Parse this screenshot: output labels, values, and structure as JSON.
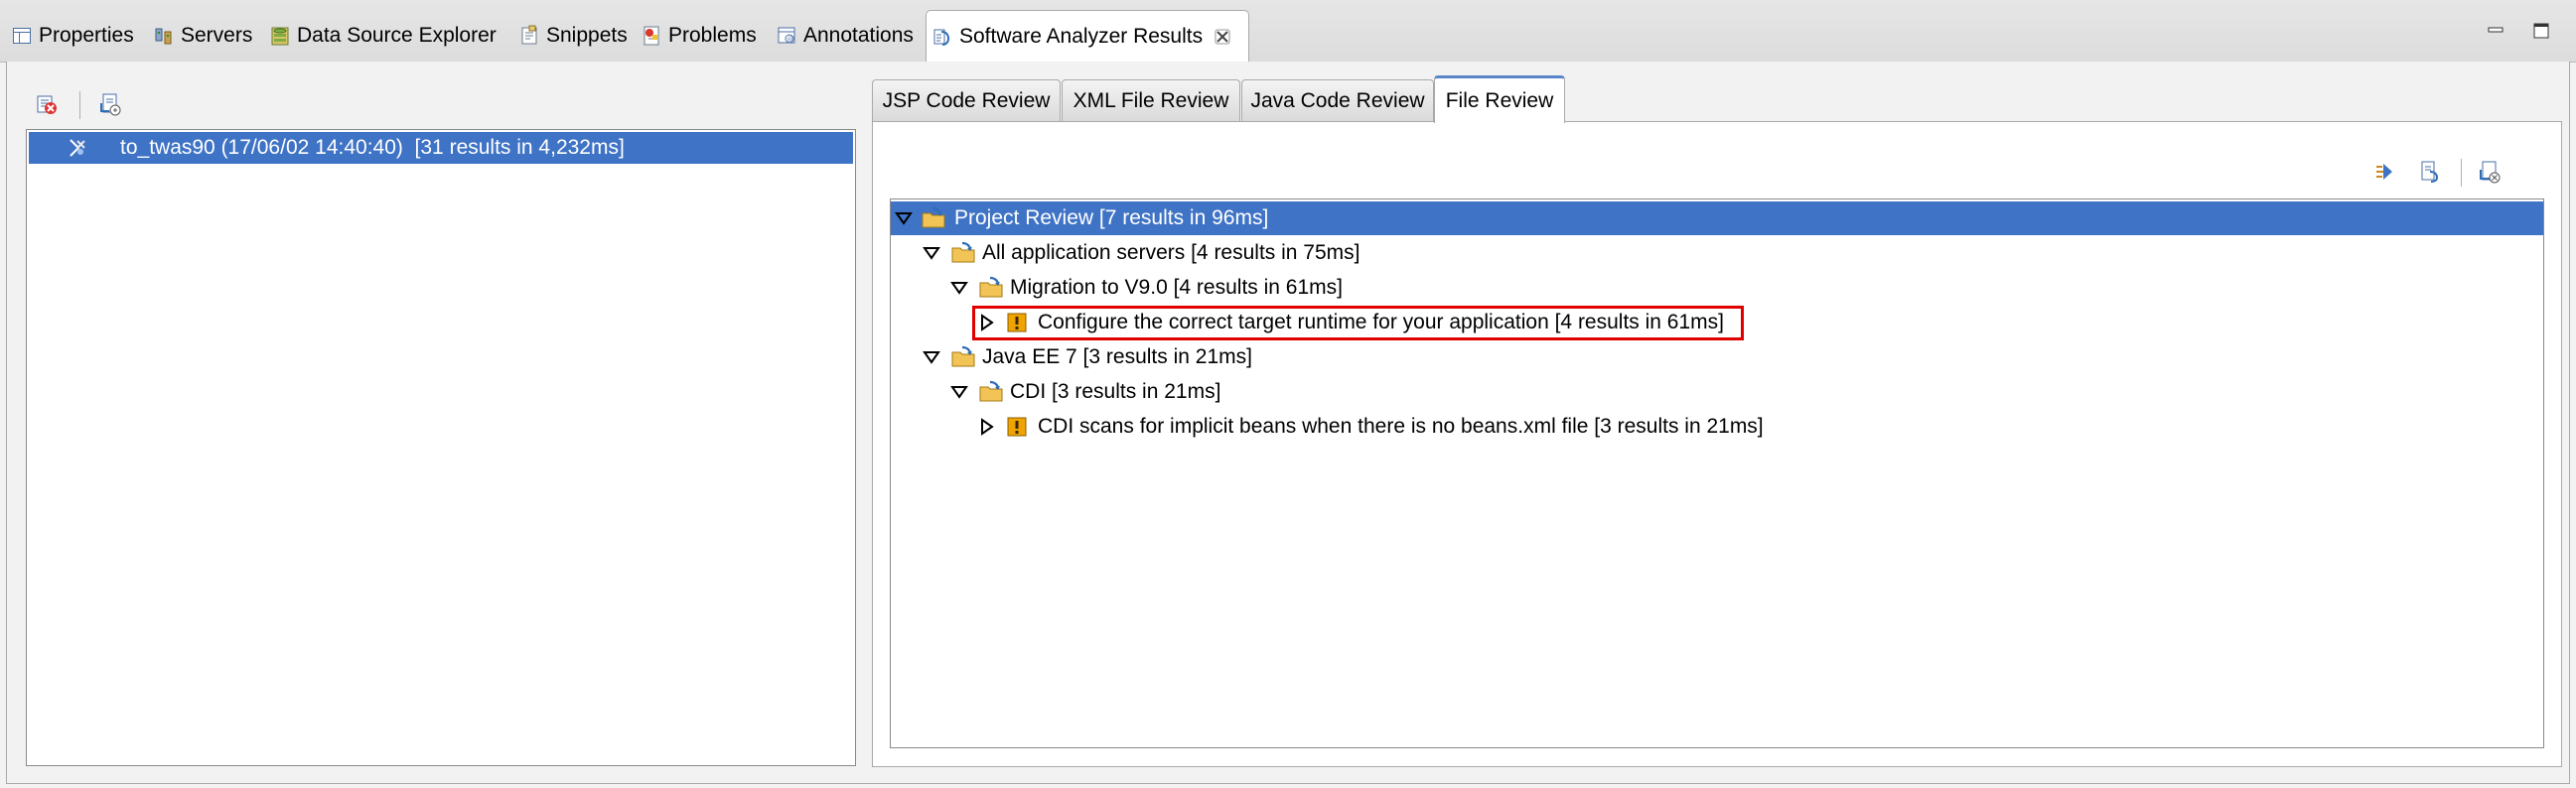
{
  "view_tabs": [
    {
      "label": "Properties",
      "icon": "properties-icon"
    },
    {
      "label": "Servers",
      "icon": "servers-icon"
    },
    {
      "label": "Data Source Explorer",
      "icon": "data-source-icon"
    },
    {
      "label": "Snippets",
      "icon": "snippets-icon"
    },
    {
      "label": "Problems",
      "icon": "problems-icon"
    },
    {
      "label": "Annotations",
      "icon": "annotations-icon"
    },
    {
      "label": "Software Analyzer Results",
      "icon": "analyzer-icon",
      "active": true
    }
  ],
  "window_controls": {
    "minimize": "minimize-icon",
    "maximize": "maximize-icon"
  },
  "results_history": {
    "toolbar": [
      "delete-results-icon",
      "export-results-icon"
    ],
    "runs": [
      {
        "label": "to_twas90 (17/06/02 14:40:40)  [31 results in 4,232ms]",
        "selected": true
      }
    ]
  },
  "review_tabs": [
    {
      "label": "JSP Code Review"
    },
    {
      "label": "XML File Review"
    },
    {
      "label": "Java Code Review"
    },
    {
      "label": "File Review",
      "active": true
    }
  ],
  "review_toolbar": [
    "quick-fix-icon",
    "generate-report-icon",
    "export-icon"
  ],
  "tree": [
    {
      "label": "Project Review [7 results in 96ms]",
      "level": 0,
      "expanded": true,
      "icon": "folder-rule-icon",
      "selected": true
    },
    {
      "label": "All application servers [4 results in 75ms]",
      "level": 1,
      "expanded": true,
      "icon": "folder-rule-icon"
    },
    {
      "label": "Migration to V9.0 [4 results in 61ms]",
      "level": 2,
      "expanded": true,
      "icon": "folder-rule-icon"
    },
    {
      "label": "Configure the correct target runtime for your application [4 results in 61ms]",
      "level": 3,
      "expanded": false,
      "icon": "warning-icon",
      "highlighted": true
    },
    {
      "label": "Java EE 7 [3 results in 21ms]",
      "level": 1,
      "expanded": true,
      "icon": "folder-rule-icon"
    },
    {
      "label": "CDI [3 results in 21ms]",
      "level": 2,
      "expanded": true,
      "icon": "folder-rule-icon"
    },
    {
      "label": "CDI scans for implicit beans when there is no beans.xml file [3 results in 21ms]",
      "level": 3,
      "expanded": false,
      "icon": "warning-icon"
    }
  ],
  "colors": {
    "selection": "#3f73c5",
    "highlight_border": "#e00000",
    "warning": "#f0a400"
  }
}
